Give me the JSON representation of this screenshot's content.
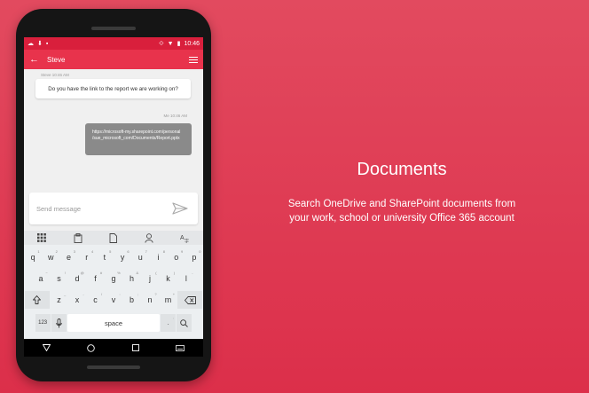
{
  "status_bar": {
    "time": "10:46"
  },
  "app_bar": {
    "title": "Steve"
  },
  "chat": {
    "incoming_meta": "Steve 10:46 AM",
    "incoming_text": "Do you have the link to the report we are working on?",
    "outgoing_meta": "Me 10:46 AM",
    "outgoing_line1": "https://microsoft-my.sharepoint.com/personal",
    "outgoing_line2": "/sue_microsoft_com/Documents/Report.pptx"
  },
  "compose": {
    "placeholder": "Send message"
  },
  "keyboard": {
    "row1": [
      {
        "k": "q",
        "h": "1"
      },
      {
        "k": "w",
        "h": "2"
      },
      {
        "k": "e",
        "h": "3"
      },
      {
        "k": "r",
        "h": "4"
      },
      {
        "k": "t",
        "h": "5"
      },
      {
        "k": "y",
        "h": "6"
      },
      {
        "k": "u",
        "h": "7"
      },
      {
        "k": "i",
        "h": "8"
      },
      {
        "k": "o",
        "h": "9"
      },
      {
        "k": "p",
        "h": "0"
      }
    ],
    "row2": [
      {
        "k": "a",
        "h": "~"
      },
      {
        "k": "s",
        "h": "!"
      },
      {
        "k": "d",
        "h": "@"
      },
      {
        "k": "f",
        "h": "#"
      },
      {
        "k": "g",
        "h": "%"
      },
      {
        "k": "h",
        "h": "&"
      },
      {
        "k": "j",
        "h": "("
      },
      {
        "k": "k",
        "h": ")"
      },
      {
        "k": "l",
        "h": "-"
      }
    ],
    "row3": [
      {
        "k": "z",
        "h": "_"
      },
      {
        "k": "x",
        "h": "-"
      },
      {
        "k": "c",
        "h": "/"
      },
      {
        "k": "v",
        "h": ":"
      },
      {
        "k": "b",
        "h": ";"
      },
      {
        "k": "n",
        "h": "?"
      },
      {
        "k": "m",
        "h": "+"
      }
    ],
    "numbers_label": "123",
    "space_label": "space",
    "period_label": ".",
    "period_hint": ","
  },
  "promo": {
    "headline": "Documents",
    "line1": "Search OneDrive and SharePoint documents from",
    "line2": "your work, school or university Office 365 account"
  },
  "colors": {
    "accent": "#e8334c",
    "background": "#dc2f4a"
  },
  "icons": {
    "status_left": [
      "cloud-icon",
      "download-icon",
      "android-icon"
    ],
    "status_right": [
      "vibrate-icon",
      "wifi-icon",
      "battery-icon"
    ],
    "keyboard_toolbar": [
      "grid-icon",
      "clipboard-icon",
      "document-icon",
      "person-icon",
      "translate-icon"
    ]
  }
}
